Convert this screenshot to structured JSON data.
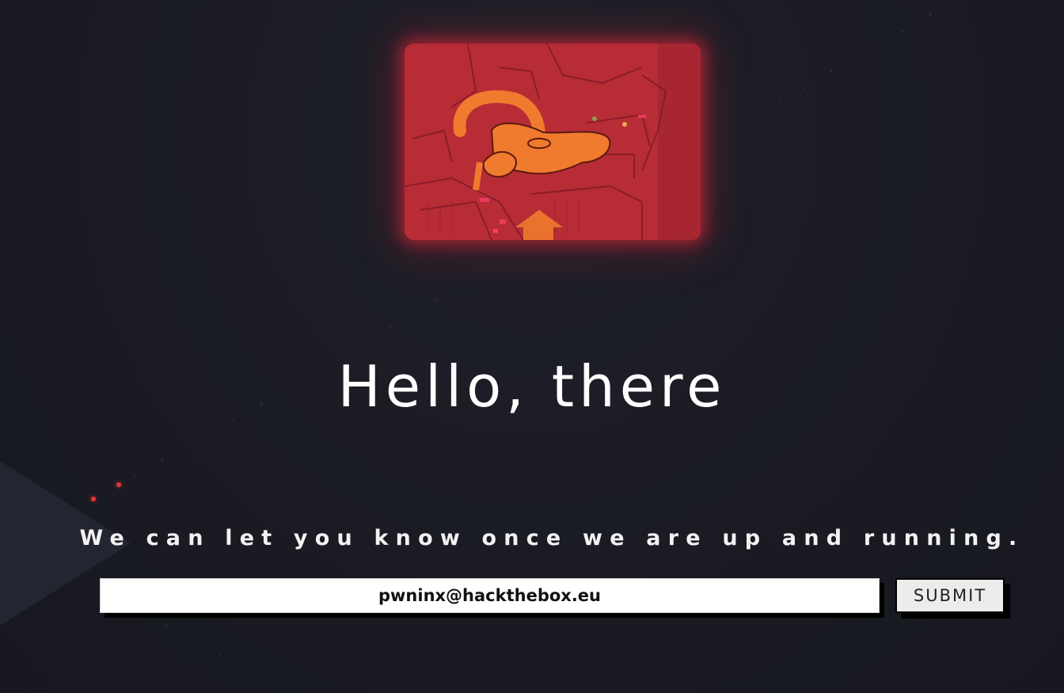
{
  "hero": {
    "image_name": "hero-cartoon-image",
    "glow_color": "#e6283c",
    "tint_color": "#b92b36"
  },
  "heading": "Hello, there",
  "subheading": "We can let you know once we are up and running.",
  "form": {
    "email_value": "pwninx@hackthebox.eu",
    "submit_label": "SUBMIT"
  },
  "colors": {
    "background": "#1a1b23",
    "accent": "#e2333b"
  }
}
